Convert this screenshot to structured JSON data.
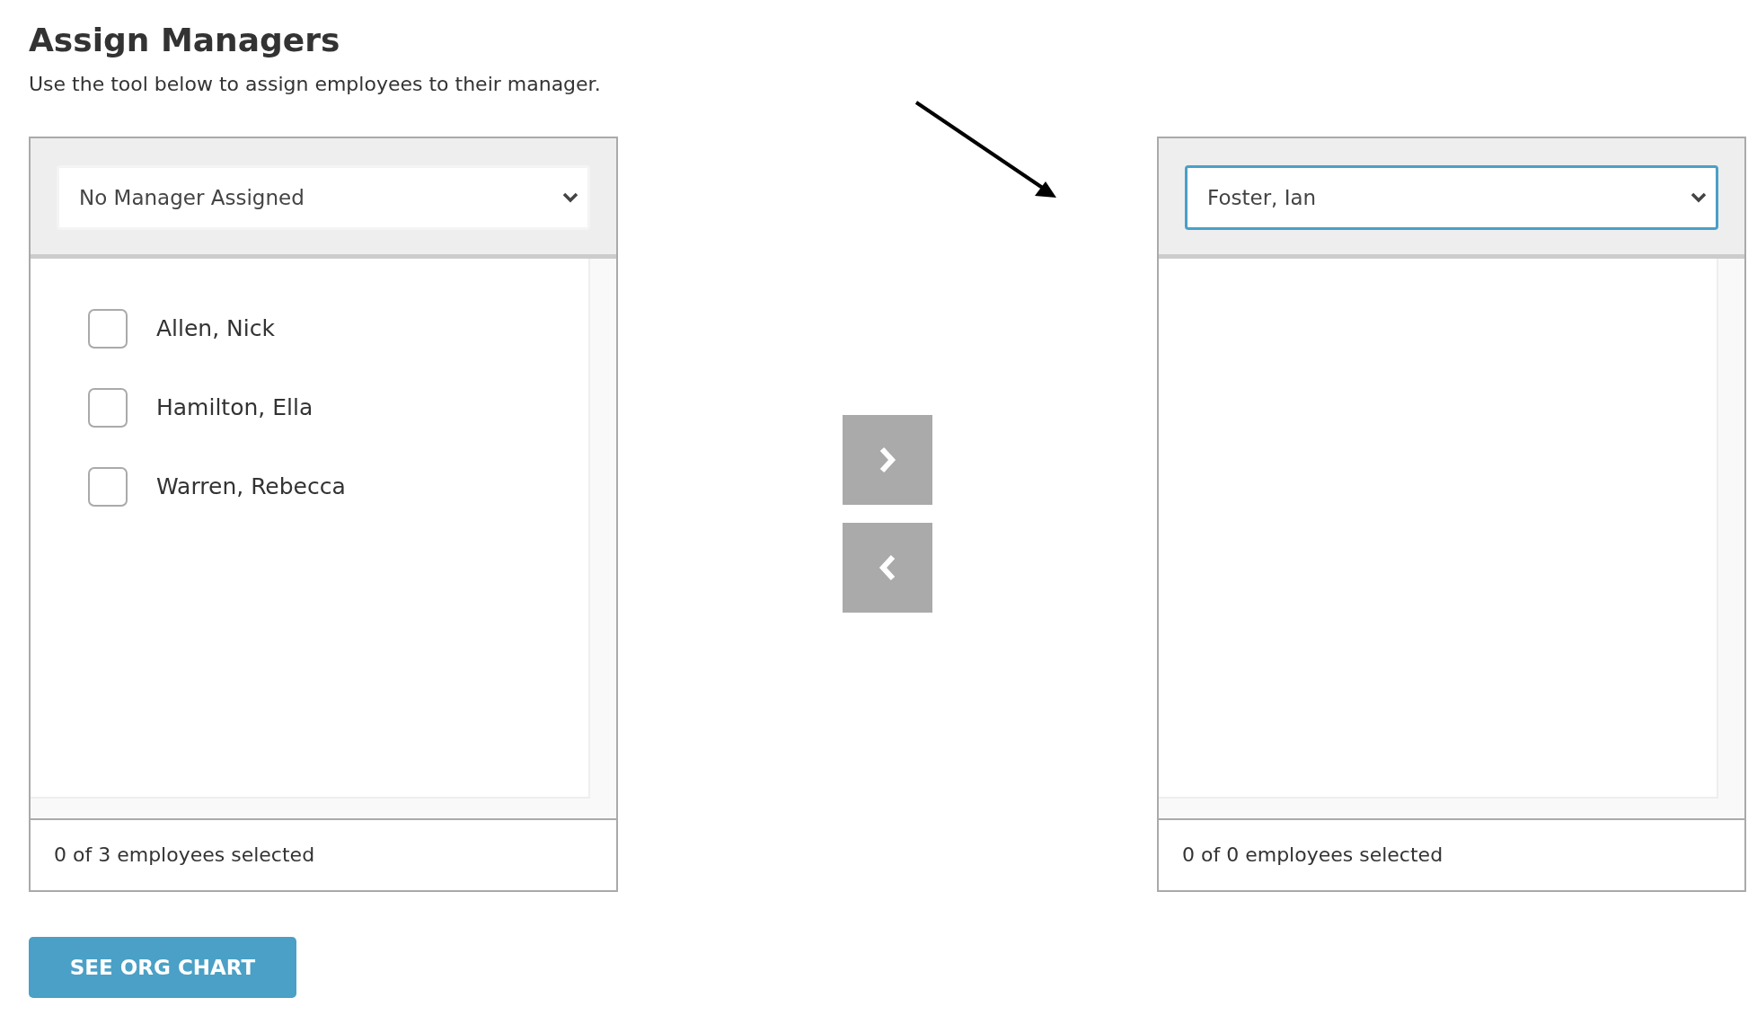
{
  "page": {
    "title": "Assign Managers",
    "subtitle": "Use the tool below to assign employees to their manager."
  },
  "panels": [
    {
      "manager_select": {
        "value": "No Manager Assigned",
        "focused": false
      },
      "employees": [
        {
          "name": "Allen, Nick",
          "checked": false
        },
        {
          "name": "Hamilton, Ella",
          "checked": false
        },
        {
          "name": "Warren, Rebecca",
          "checked": false
        }
      ],
      "footer": "0 of 3 employees selected"
    },
    {
      "manager_select": {
        "value": "Foster, Ian",
        "focused": true
      },
      "footer": "0 of 0 employees selected"
    }
  ],
  "actions": [
    {
      "label": "SEE ORG CHART"
    }
  ]
}
